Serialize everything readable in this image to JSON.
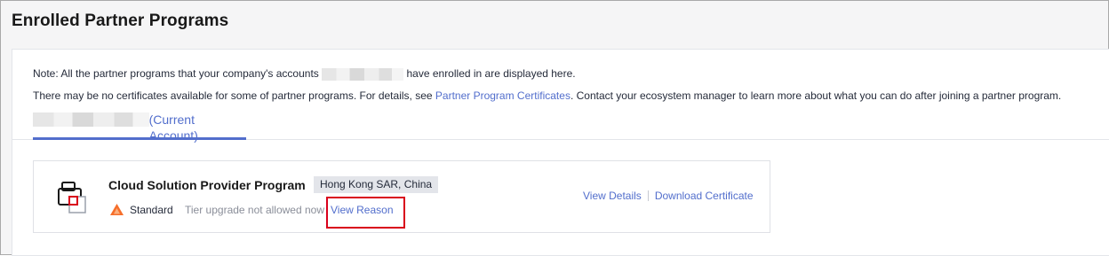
{
  "page": {
    "title": "Enrolled Partner Programs"
  },
  "notes": {
    "line1_before": "Note: All the partner programs that your company's accounts",
    "line1_after": "have enrolled in are displayed here.",
    "line2_before": "There may be no certificates available for some of partner programs. For details, see",
    "line2_link": "Partner Program Certificates",
    "line2_after": ". Contact your ecosystem manager to learn more about what you can do after joining a partner program."
  },
  "tabs": [
    {
      "label": "(Current Account)",
      "active": true
    }
  ],
  "program_card": {
    "name": "Cloud Solution Provider Program",
    "region": "Hong Kong SAR, China",
    "tier": "Standard",
    "tier_status": "Tier upgrade not allowed now",
    "reason_link": "View Reason",
    "actions": {
      "view_details": "View Details",
      "download_certificate": "Download Certificate"
    },
    "icons": {
      "program": "briefcase-icon",
      "tier": "standard-tier-icon"
    }
  },
  "colors": {
    "link": "#526ecc",
    "highlight_border": "#d9001b",
    "tier_icon": "#f66f2b",
    "program_icon_accent": "#d9001b"
  }
}
